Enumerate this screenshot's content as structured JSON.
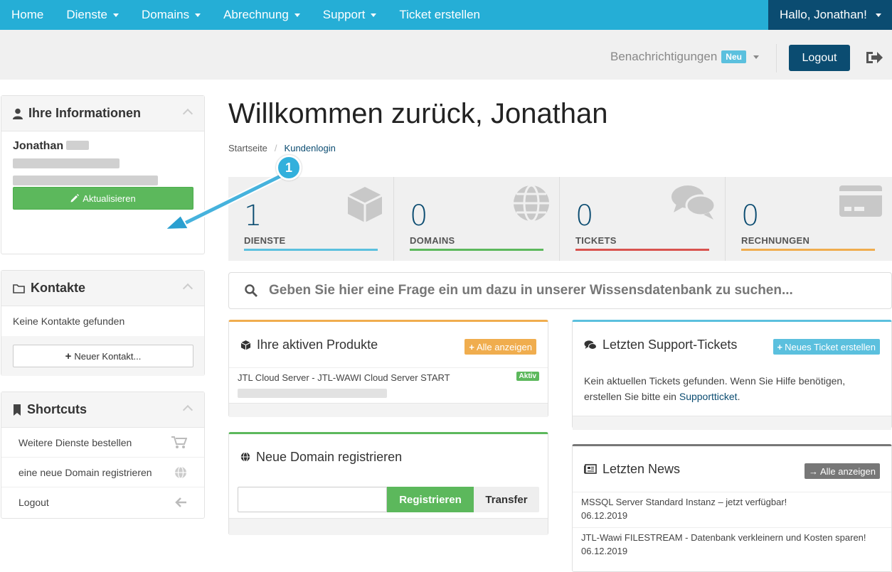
{
  "nav": {
    "items": [
      "Home",
      "Dienste",
      "Domains",
      "Abrechnung",
      "Support",
      "Ticket erstellen"
    ],
    "user_greeting": "Hallo, Jonathan!"
  },
  "subbar": {
    "notifications": "Benachrichtigungen",
    "notifications_badge": "Neu",
    "logout": "Logout"
  },
  "sidebar": {
    "info": {
      "title": "Ihre Informationen",
      "name": "Jonathan",
      "update_button": "Aktualisieren"
    },
    "contacts": {
      "title": "Kontakte",
      "empty_text": "Keine Kontakte gefunden",
      "new_contact_button": "Neuer Kontakt..."
    },
    "shortcuts": {
      "title": "Shortcuts",
      "items": [
        {
          "label": "Weitere Dienste bestellen",
          "icon": "cart-icon"
        },
        {
          "label": "eine neue Domain registrieren",
          "icon": "globe-icon"
        },
        {
          "label": "Logout",
          "icon": "arrow-left-icon"
        }
      ]
    }
  },
  "main": {
    "welcome": "Willkommen zurück, Jonathan",
    "breadcrumb": [
      "Startseite",
      "Kundenlogin"
    ],
    "tiles": [
      {
        "value": "1",
        "label": "DIENSTE",
        "color": "#5bc0de",
        "icon": "box-icon"
      },
      {
        "value": "0",
        "label": "DOMAINS",
        "color": "#5cb85c",
        "icon": "globe-icon"
      },
      {
        "value": "0",
        "label": "TICKETS",
        "color": "#d9534f",
        "icon": "comments-icon"
      },
      {
        "value": "0",
        "label": "RECHNUNGEN",
        "color": "#f0ad4e",
        "icon": "credit-card-icon"
      }
    ],
    "search_placeholder": "Geben Sie hier eine Frage ein um dazu in unserer Wissensdatenbank zu suchen...",
    "products": {
      "title": "Ihre aktiven Produkte",
      "view_all": "Alle anzeigen",
      "items": [
        {
          "name": "JTL Cloud Server - JTL-WAWI Cloud Server START",
          "status": "Aktiv"
        }
      ]
    },
    "domain_register": {
      "title": "Neue Domain registrieren",
      "register_button": "Registrieren",
      "transfer_button": "Transfer"
    },
    "tickets": {
      "title": "Letzten Support-Tickets",
      "new_ticket_button": "Neues Ticket erstellen",
      "empty_text_1": "Kein aktuellen Tickets gefunden. Wenn Sie Hilfe benötigen,",
      "empty_text_2": "erstellen Sie bitte ein",
      "empty_link": "Supportticket",
      "empty_text_3": "."
    },
    "news": {
      "title": "Letzten News",
      "view_all": "Alle anzeigen",
      "items": [
        {
          "title": "MSSQL Server Standard Instanz – jetzt verfügbar!",
          "date": "06.12.2019"
        },
        {
          "title": "JTL-Wawi FILESTREAM - Datenbank verkleinern und Kosten sparen!",
          "date": "06.12.2019"
        }
      ]
    }
  },
  "annotation": {
    "marker": "1"
  },
  "colors": {
    "nav": "#25aed6",
    "dark": "#0b4c71",
    "green": "#5cb85c",
    "orange": "#f0ad4e",
    "info": "#5bc0de",
    "grey": "#777777"
  }
}
